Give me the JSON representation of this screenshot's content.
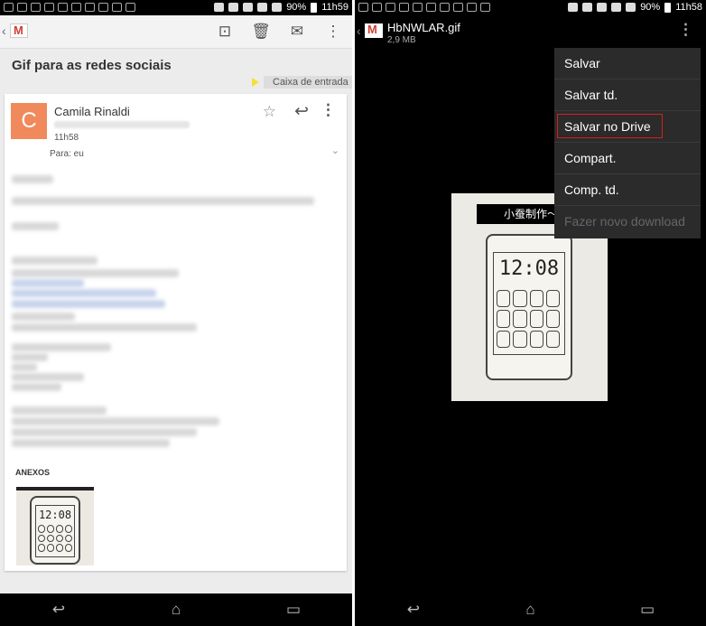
{
  "left": {
    "status": {
      "battery": "90%",
      "time": "11h59"
    },
    "app": "gmail",
    "actions": [
      "archive",
      "delete",
      "mark-unread",
      "overflow"
    ],
    "subject": "Gif para as redes sociais",
    "label": "Caixa de entrada",
    "message": {
      "avatar_letter": "C",
      "sender": "Camila Rinaldi",
      "time": "11h58",
      "to": "Para: eu"
    },
    "attachments_label": "ANEXOS",
    "attachment_clock": "12:08"
  },
  "right": {
    "status": {
      "battery": "90%",
      "time": "11h58"
    },
    "file_name": "HbNWLAR.gif",
    "file_size": "2,9 MB",
    "gif_caption": "小蚕制作～",
    "gif_clock": "12:08",
    "menu": [
      {
        "label": "Salvar",
        "enabled": true
      },
      {
        "label": "Salvar td.",
        "enabled": true
      },
      {
        "label": "Salvar no Drive",
        "enabled": true,
        "highlighted": true
      },
      {
        "label": "Compart.",
        "enabled": true
      },
      {
        "label": "Comp. td.",
        "enabled": true
      },
      {
        "label": "Fazer novo download",
        "enabled": false
      }
    ]
  },
  "accent": {
    "highlight_border": "#d81e1e",
    "avatar": "#f08a5d",
    "label_tag": "#f3e03a"
  }
}
